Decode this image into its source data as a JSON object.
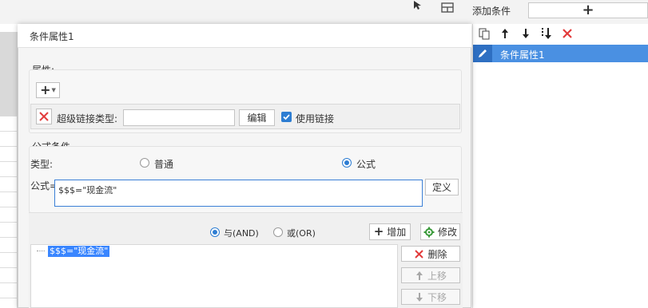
{
  "right_panel": {
    "title": "添加条件",
    "add_button_label": "+",
    "toolbar_icons": [
      "copy-icon",
      "arrow-up-icon",
      "arrow-down-icon",
      "move-bottom-icon",
      "delete-icon"
    ],
    "items": [
      {
        "label": "条件属性1",
        "selected": true
      }
    ]
  },
  "dialog": {
    "title": "条件属性1",
    "attributes": {
      "group_label": "属性:",
      "add_button": "+",
      "hyperlink_type_label": "超级链接类型:",
      "hyperlink_type_value": "",
      "edit_button": "编辑",
      "use_link_label": "使用链接",
      "use_link_checked": true
    },
    "formula_condition": {
      "group_label": "公式条件",
      "type_label": "类型:",
      "option_normal": "普通",
      "option_formula": "公式",
      "selected_type": "formula",
      "formula_label": "公式=",
      "formula_value": "$$$=\"现金流\"",
      "define_button": "定义"
    },
    "logic": {
      "option_and": "与(AND)",
      "option_or": "或(OR)",
      "selected": "and",
      "add_button": "增加",
      "modify_button": "修改"
    },
    "condition_list": {
      "items": [
        "$$$=\"现金流\""
      ],
      "delete_button": "删除",
      "move_up_button": "上移",
      "move_down_button": "下移"
    }
  },
  "colors": {
    "accent": "#2d7dd2",
    "selection": "#4a90e2",
    "delete_red": "#e23b3b"
  }
}
